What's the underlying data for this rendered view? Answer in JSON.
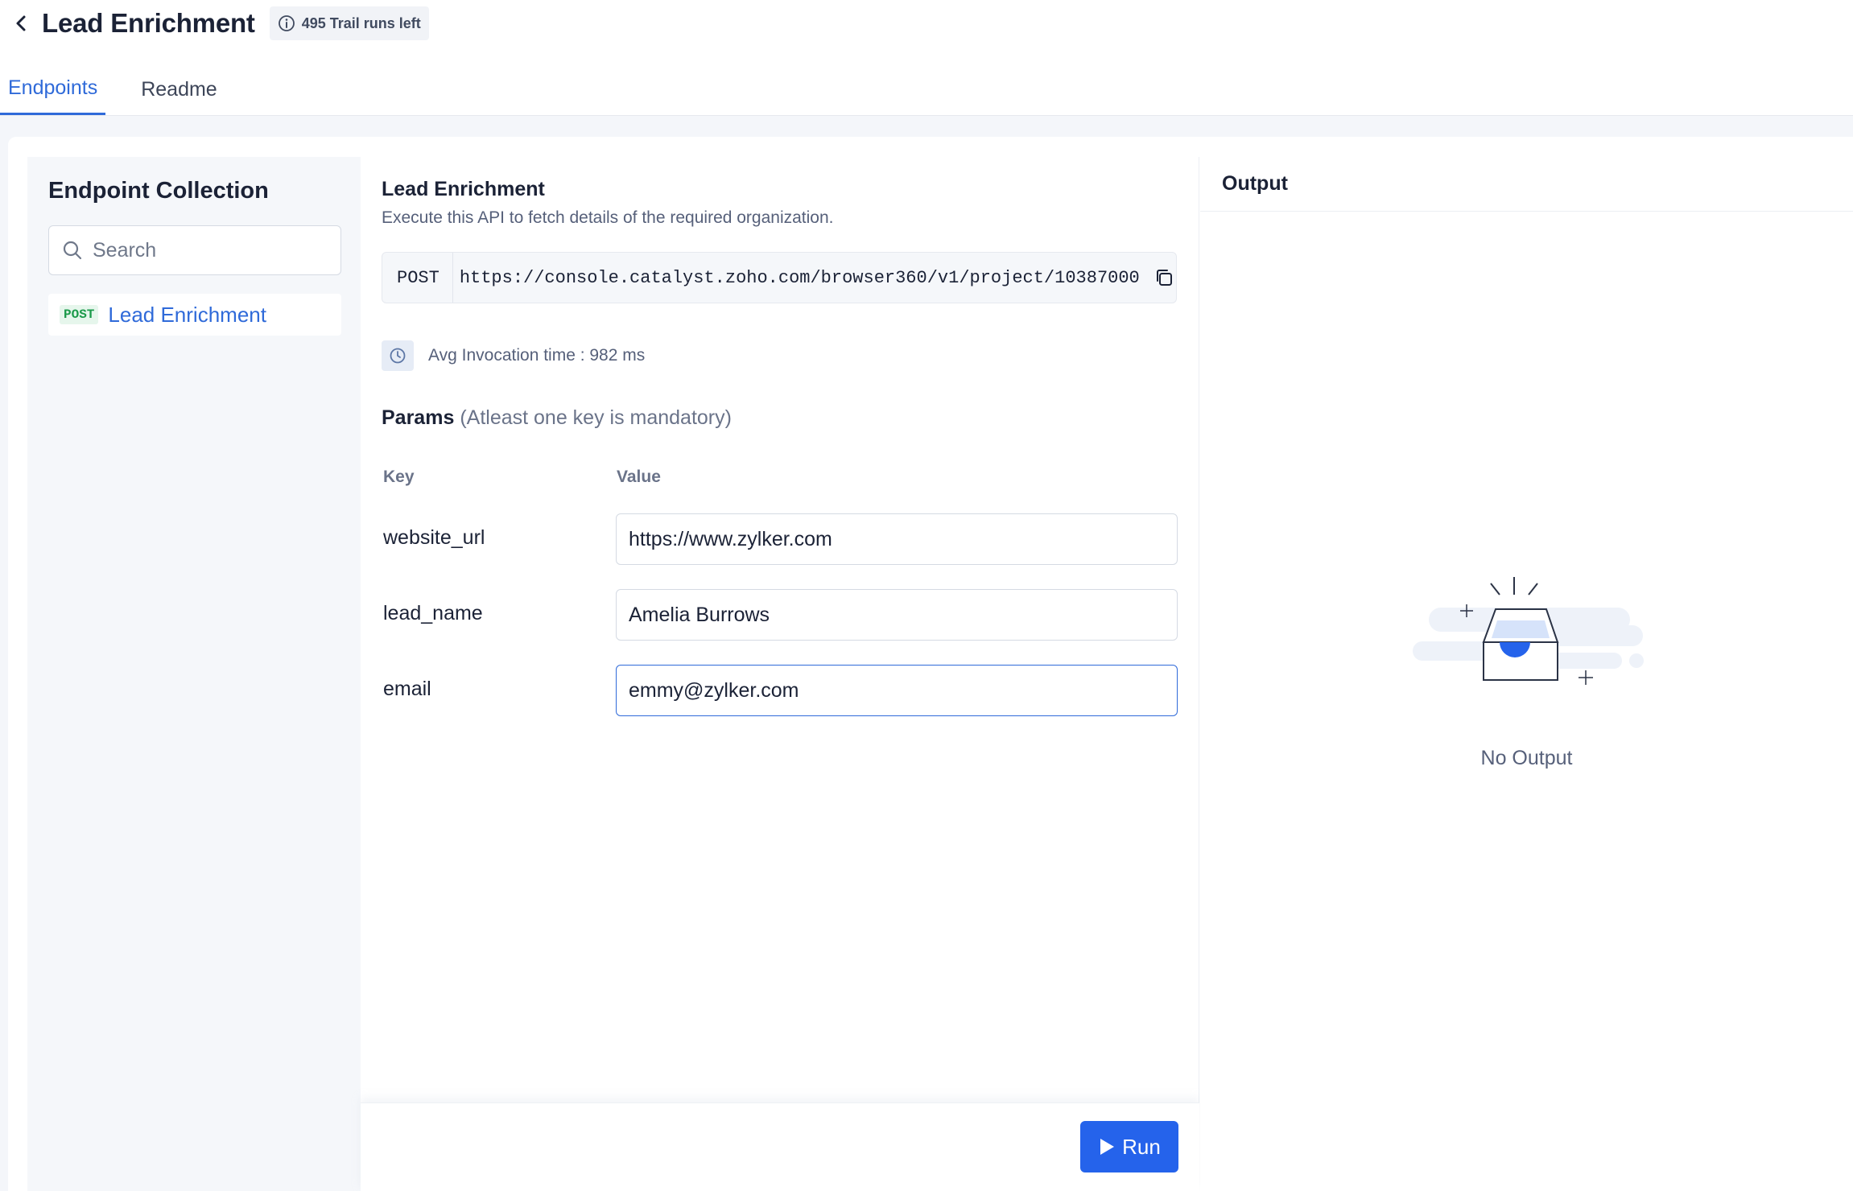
{
  "header": {
    "title": "Lead Enrichment",
    "trial_badge": "495 Trail runs left"
  },
  "tabs": [
    {
      "label": "Endpoints",
      "active": true
    },
    {
      "label": "Readme",
      "active": false
    }
  ],
  "sidebar": {
    "title": "Endpoint Collection",
    "search_placeholder": "Search",
    "items": [
      {
        "method": "POST",
        "name": "Lead Enrichment",
        "selected": true
      }
    ]
  },
  "endpoint": {
    "title": "Lead Enrichment",
    "description": "Execute this API to fetch details of the required organization.",
    "method": "POST",
    "url": "https://console.catalyst.zoho.com/browser360/v1/project/10387000",
    "avg_invocation": "Avg Invocation time : 982 ms",
    "params_title": "Params",
    "params_note": "(Atleast one key is mandatory)",
    "columns": {
      "key": "Key",
      "value": "Value"
    },
    "params": [
      {
        "key": "website_url",
        "value": "https://www.zylker.com"
      },
      {
        "key": "lead_name",
        "value": "Amelia Burrows"
      },
      {
        "key": "email",
        "value": "emmy@zylker.com"
      }
    ],
    "run_label": "Run"
  },
  "output": {
    "title": "Output",
    "empty_text": "No Output"
  },
  "colors": {
    "accent": "#2f6ad9",
    "run_button": "#2563eb",
    "post_tag": "#1b9a4a"
  }
}
